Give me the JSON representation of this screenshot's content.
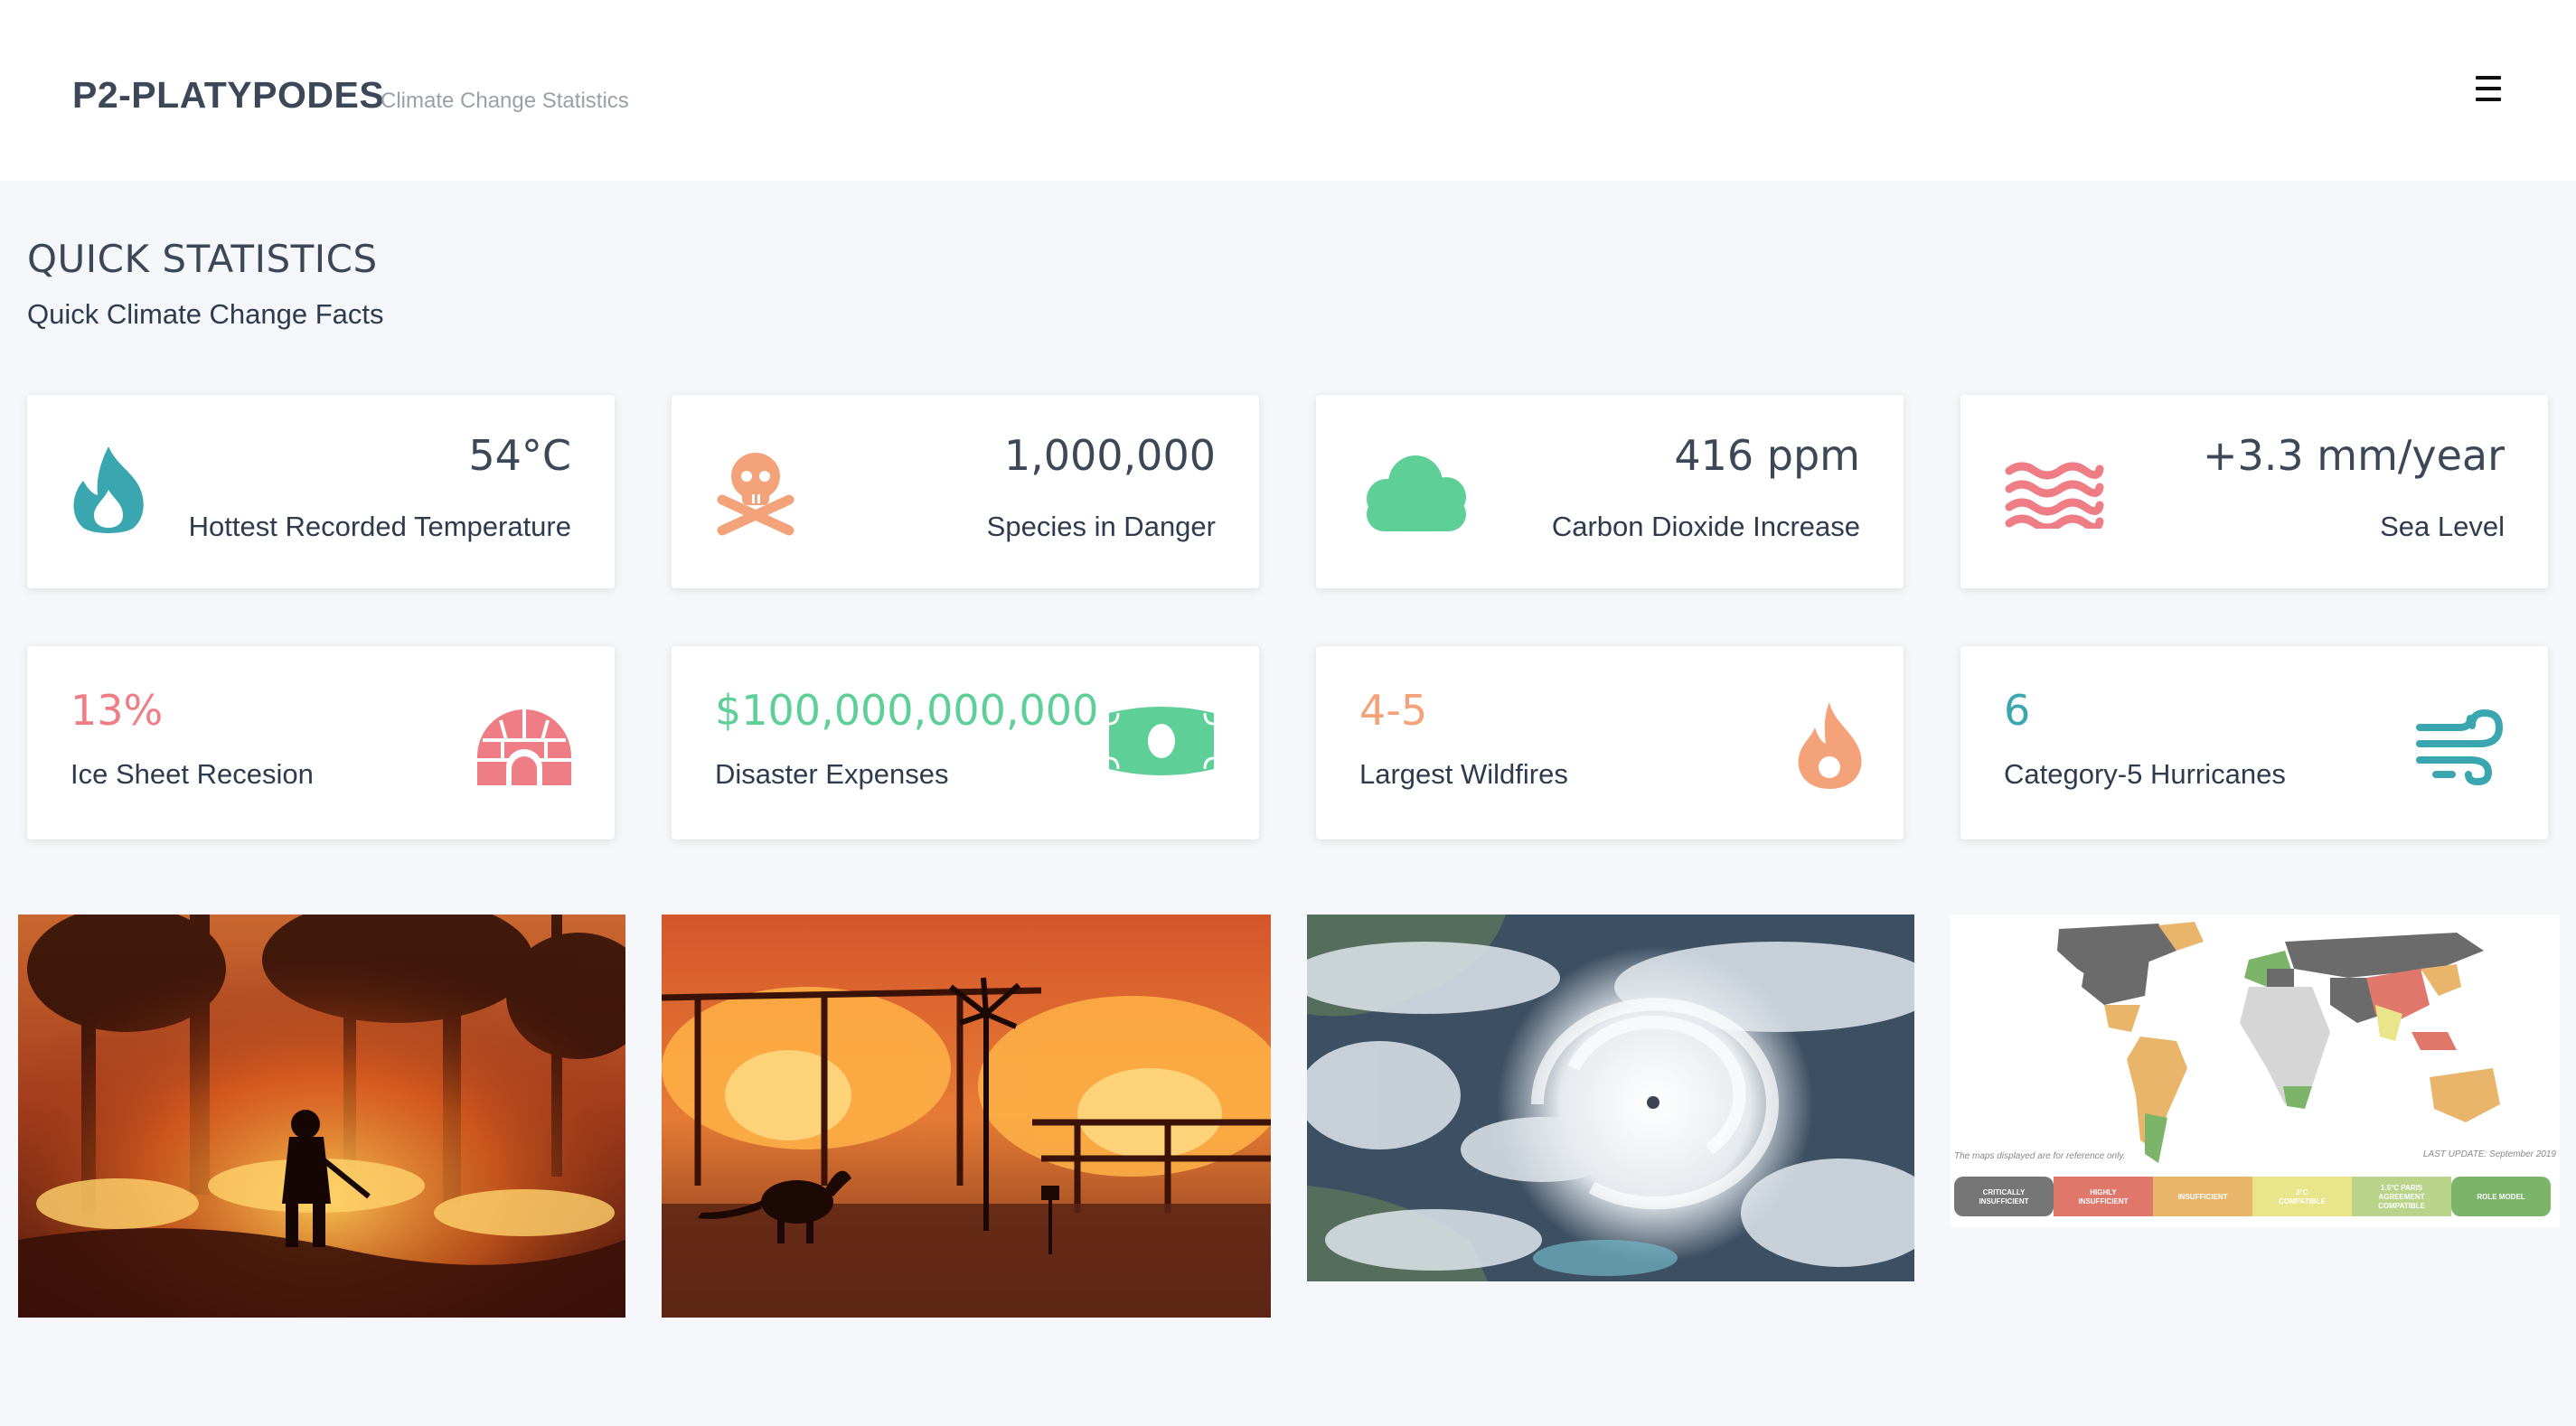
{
  "header": {
    "brand": "P2-PLATYPODES",
    "subtitle": "Climate Change Statistics",
    "menu_icon": "hamburger-menu-icon"
  },
  "section": {
    "title": "QUICK STATISTICS",
    "subtitle": "Quick Climate Change Facts"
  },
  "stats_row1": [
    {
      "value": "54°C",
      "label": "Hottest Recorded Temperature",
      "icon": "fire-drop-icon",
      "color": "#3aa7b0"
    },
    {
      "value": "1,000,000",
      "label": "Species in Danger",
      "icon": "skull-crossbones-icon",
      "color": "#f4a27a"
    },
    {
      "value": "416 ppm",
      "label": "Carbon Dioxide Increase",
      "icon": "cloud-icon",
      "color": "#5fcf98"
    },
    {
      "value": "+3.3 mm/year",
      "label": "Sea Level",
      "icon": "water-waves-icon",
      "color": "#ef7d86"
    }
  ],
  "stats_row2": [
    {
      "value": "13%",
      "label": "Ice Sheet Recesion",
      "icon": "igloo-icon",
      "color": "#ef7d86"
    },
    {
      "value": "$100,000,000,000",
      "label": "Disaster Expenses",
      "icon": "money-bill-icon",
      "color": "#5fcf98"
    },
    {
      "value": "4-5",
      "label": "Largest Wildfires",
      "icon": "flame-icon",
      "color": "#f4a27a"
    },
    {
      "value": "6",
      "label": "Category-5 Hurricanes",
      "icon": "wind-icon",
      "color": "#3aa7b0"
    }
  ],
  "images": [
    {
      "name": "firefighter-wildfire-photo"
    },
    {
      "name": "kangaroo-bushfire-photo"
    },
    {
      "name": "hurricane-satellite-photo"
    },
    {
      "name": "climate-world-map",
      "note": "The maps displayed are for reference only.",
      "update": "LAST UPDATE: September 2019",
      "legend": [
        "CRITICALLY INSUFFICIENT",
        "HIGHLY INSUFFICIENT",
        "INSUFFICIENT",
        "2°C COMPATIBLE",
        "1.5°C PARIS AGREEMENT COMPATIBLE",
        "ROLE MODEL"
      ],
      "legend_colors": [
        "#767676",
        "#e0776b",
        "#e9b56b",
        "#e8e58a",
        "#b9d48a",
        "#7cb46a"
      ]
    }
  ]
}
